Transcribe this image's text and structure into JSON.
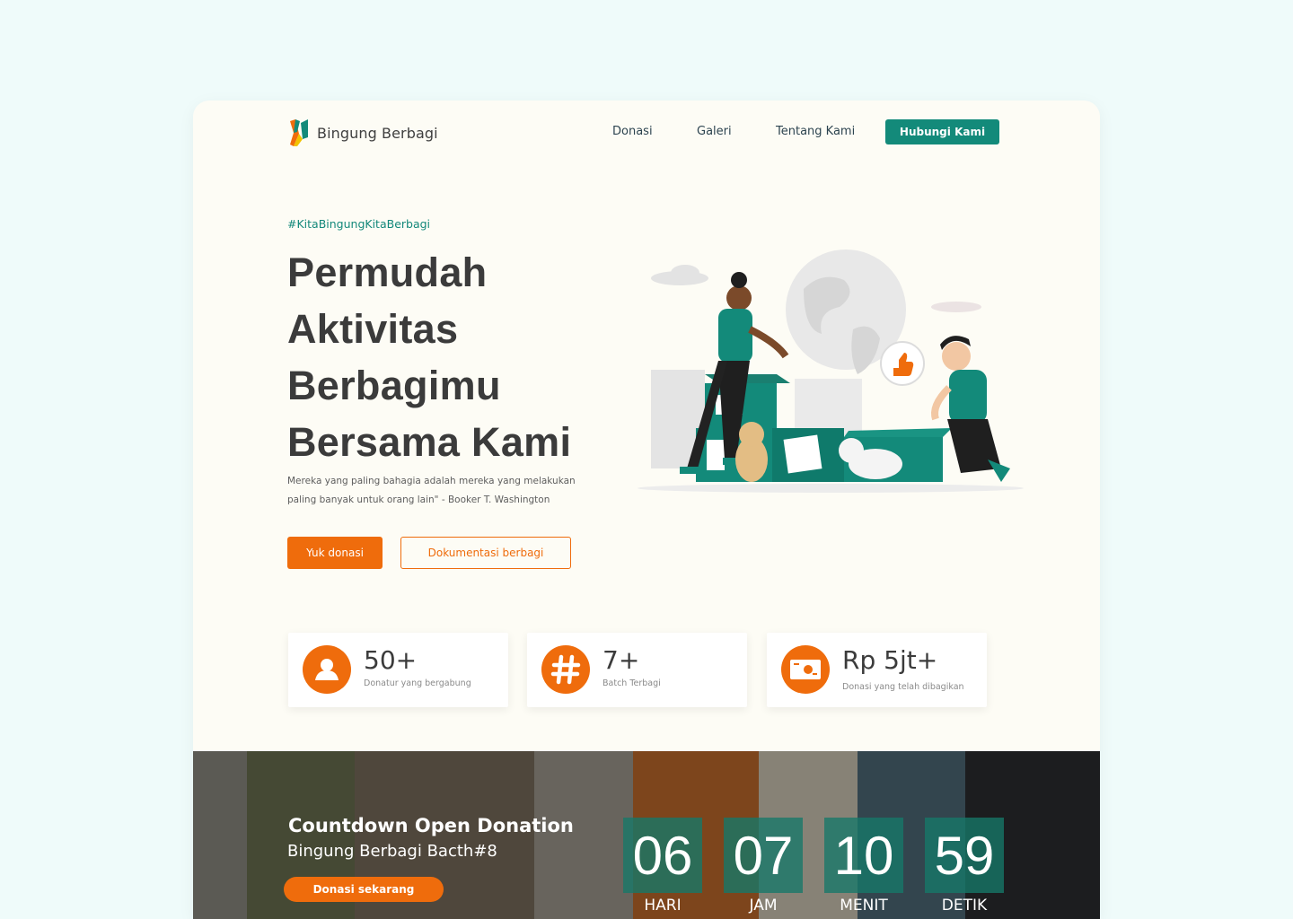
{
  "navbar": {
    "brand": "Bingung Berbagi",
    "links": [
      "Donasi",
      "Galeri",
      "Tentang Kami"
    ],
    "cta": "Hubungi Kami"
  },
  "hero": {
    "hashtag": "#KitaBingungKitaBerbagi",
    "headline": [
      "Permudah",
      "Aktivitas",
      "Berbagimu",
      "Bersama Kami"
    ],
    "quote_line1": "Mereka yang paling bahagia adalah mereka yang melakukan",
    "quote_line2": "paling banyak untuk orang lain\" - Booker T. Washington",
    "primary_button": "Yuk donasi",
    "secondary_button": "Dokumentasi berbagi"
  },
  "stats": [
    {
      "icon": "user-icon",
      "value": "50+",
      "label": "Donatur yang bergabung"
    },
    {
      "icon": "hashtag-icon",
      "value": "7+",
      "label": "Batch Terbagi"
    },
    {
      "icon": "money-icon",
      "value": "Rp 5jt+",
      "label": "Donasi yang telah dibagikan"
    }
  ],
  "countdown": {
    "title": "Countdown Open Donation",
    "subtitle": "Bingung Berbagi Bacth#8",
    "button": "Donasi sekarang",
    "units": [
      {
        "value": "06",
        "label": "HARI"
      },
      {
        "value": "07",
        "label": "JAM"
      },
      {
        "value": "10",
        "label": "MENIT"
      },
      {
        "value": "59",
        "label": "DETIK"
      }
    ]
  },
  "colors": {
    "page_background": "#effbfa",
    "card_background": "#fdfcf5",
    "teal": "#138a7a",
    "orange": "#ef6c0c",
    "heading": "#3b3b3b"
  }
}
